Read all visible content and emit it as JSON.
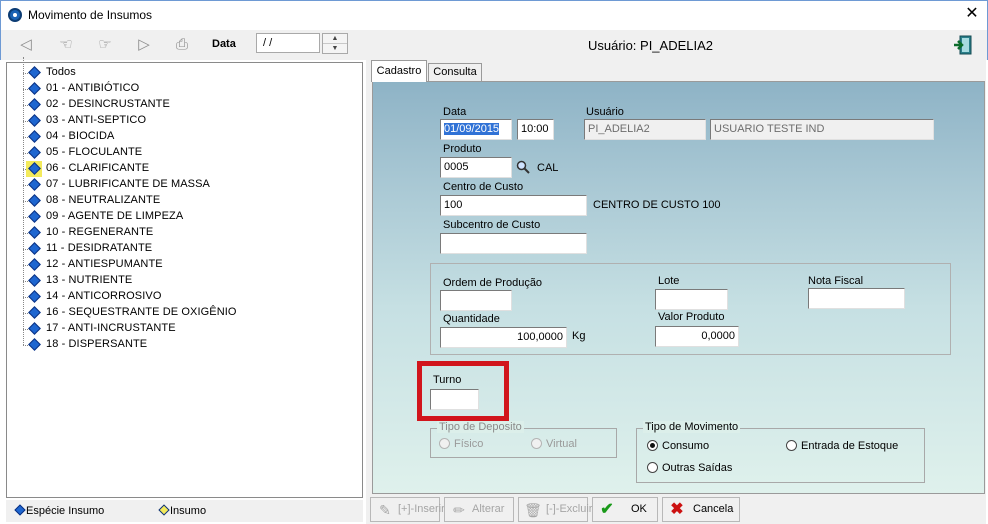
{
  "window": {
    "title": "Movimento de Insumos",
    "close_glyph": "✕"
  },
  "toolbar": {
    "date_label": "Data",
    "date_value": " / /",
    "user_label": "Usuário: PI_ADELIA2",
    "icons": [
      "first-record-icon",
      "previous-record-icon",
      "next-record-icon",
      "last-record-icon",
      "print-icon",
      "exit-icon"
    ]
  },
  "tree": {
    "items": [
      {
        "label": "Todos"
      },
      {
        "label": "01 - ANTIBIÓTICO"
      },
      {
        "label": "02 - DESINCRUSTANTE"
      },
      {
        "label": "03 - ANTI-SEPTICO"
      },
      {
        "label": "04 - BIOCIDA"
      },
      {
        "label": "05 - FLOCULANTE"
      },
      {
        "label": "06 - CLARIFICANTE",
        "selected": true
      },
      {
        "label": "07 - LUBRIFICANTE DE MASSA"
      },
      {
        "label": "08 - NEUTRALIZANTE"
      },
      {
        "label": "09 - AGENTE DE LIMPEZA"
      },
      {
        "label": "10 - REGENERANTE"
      },
      {
        "label": "11 - DESIDRATANTE"
      },
      {
        "label": "12 - ANTIESPUMANTE"
      },
      {
        "label": "13 - NUTRIENTE"
      },
      {
        "label": "14 - ANTICORROSIVO"
      },
      {
        "label": "16 - SEQUESTRANTE DE OXIGÊNIO"
      },
      {
        "label": "17 - ANTI-INCRUSTANTE"
      },
      {
        "label": "18 - DISPERSANTE"
      }
    ],
    "legend": {
      "especie": "Espécie Insumo",
      "insumo": "Insumo"
    }
  },
  "tabs": {
    "cadastro": "Cadastro",
    "consulta": "Consulta"
  },
  "form": {
    "data_label": "Data",
    "data_value": "01/09/2015",
    "hora_value": "10:00",
    "usuario_label": "Usuário",
    "usuario_value": "PI_ADELIA2",
    "usuario_nome": "USUARIO TESTE IND",
    "produto_label": "Produto",
    "produto_value": "0005",
    "produto_desc": "CAL",
    "centro_label": "Centro de Custo",
    "centro_value": "100",
    "centro_desc": "CENTRO DE CUSTO 100",
    "subcentro_label": "Subcentro de Custo",
    "subcentro_value": "",
    "ordem_label": "Ordem de Produção",
    "ordem_value": "",
    "lote_label": "Lote",
    "lote_value": "",
    "nota_label": "Nota Fiscal",
    "nota_value": "",
    "quantidade_label": "Quantidade",
    "quantidade_value": "100,0000",
    "quantidade_unit": "Kg",
    "valor_label": "Valor Produto",
    "valor_value": "0,0000",
    "turno_label": "Turno",
    "turno_value": "",
    "deposito": {
      "legend": "Tipo de Deposito",
      "fisico": "Físico",
      "virtual": "Virtual"
    },
    "movimento": {
      "legend": "Tipo de Movimento",
      "consumo": "Consumo",
      "entrada": "Entrada de Estoque",
      "saidas": "Outras Saídas",
      "selected": "Consumo"
    }
  },
  "buttons": {
    "inserir": "[+]-Inserir",
    "alterar": "Alterar",
    "excluir": "[-]-Excluir",
    "ok": "OK",
    "cancela": "Cancela"
  },
  "colors": {
    "highlight": "#d1151c",
    "tree_diamond": "#1e66d0",
    "ok_check": "#1a9a1a",
    "cancel_x": "#cc1111"
  }
}
